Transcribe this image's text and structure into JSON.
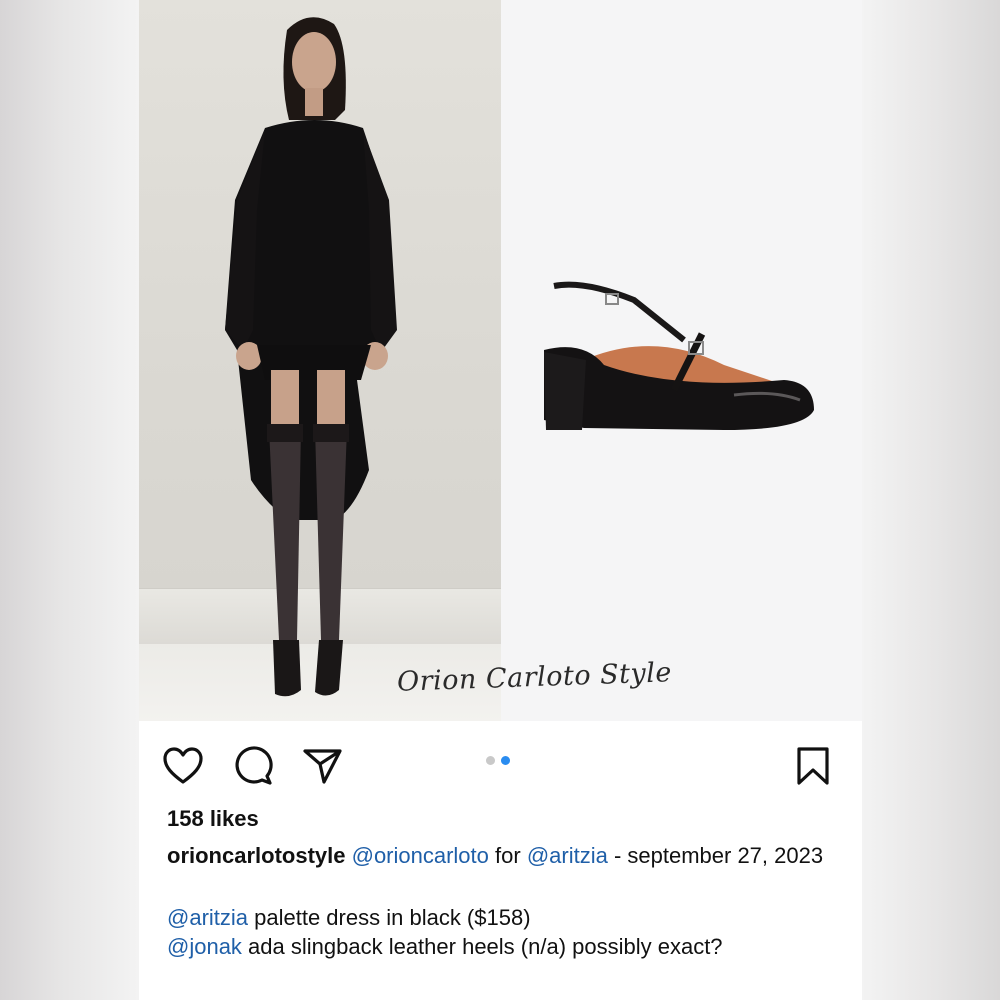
{
  "post": {
    "watermark": "Orion Carloto Style",
    "carousel": {
      "total": 2,
      "active_index": 2
    },
    "likes": "158 likes",
    "caption": {
      "username": "orioncarlotostyle",
      "line1": [
        {
          "text": "@orioncarloto",
          "type": "mention"
        },
        {
          "text": " for ",
          "type": "text"
        },
        {
          "text": "@aritzia",
          "type": "mention"
        },
        {
          "text": " - september 27, 2023",
          "type": "text"
        }
      ],
      "item1": {
        "mention": "@aritzia",
        "text": " palette dress in black ($158)"
      },
      "item2": {
        "mention": "@jonak",
        "text": " ada slingback leather heels (n/a) possibly exact?"
      }
    },
    "actions": {
      "like_icon": "heart-icon",
      "comment_icon": "comment-icon",
      "share_icon": "send-icon",
      "save_icon": "bookmark-icon"
    }
  },
  "colors": {
    "mention": "#1f5fa8",
    "dot_active": "#2a8cf0",
    "dot_inactive": "#c9c9c9",
    "text": "#111111"
  }
}
